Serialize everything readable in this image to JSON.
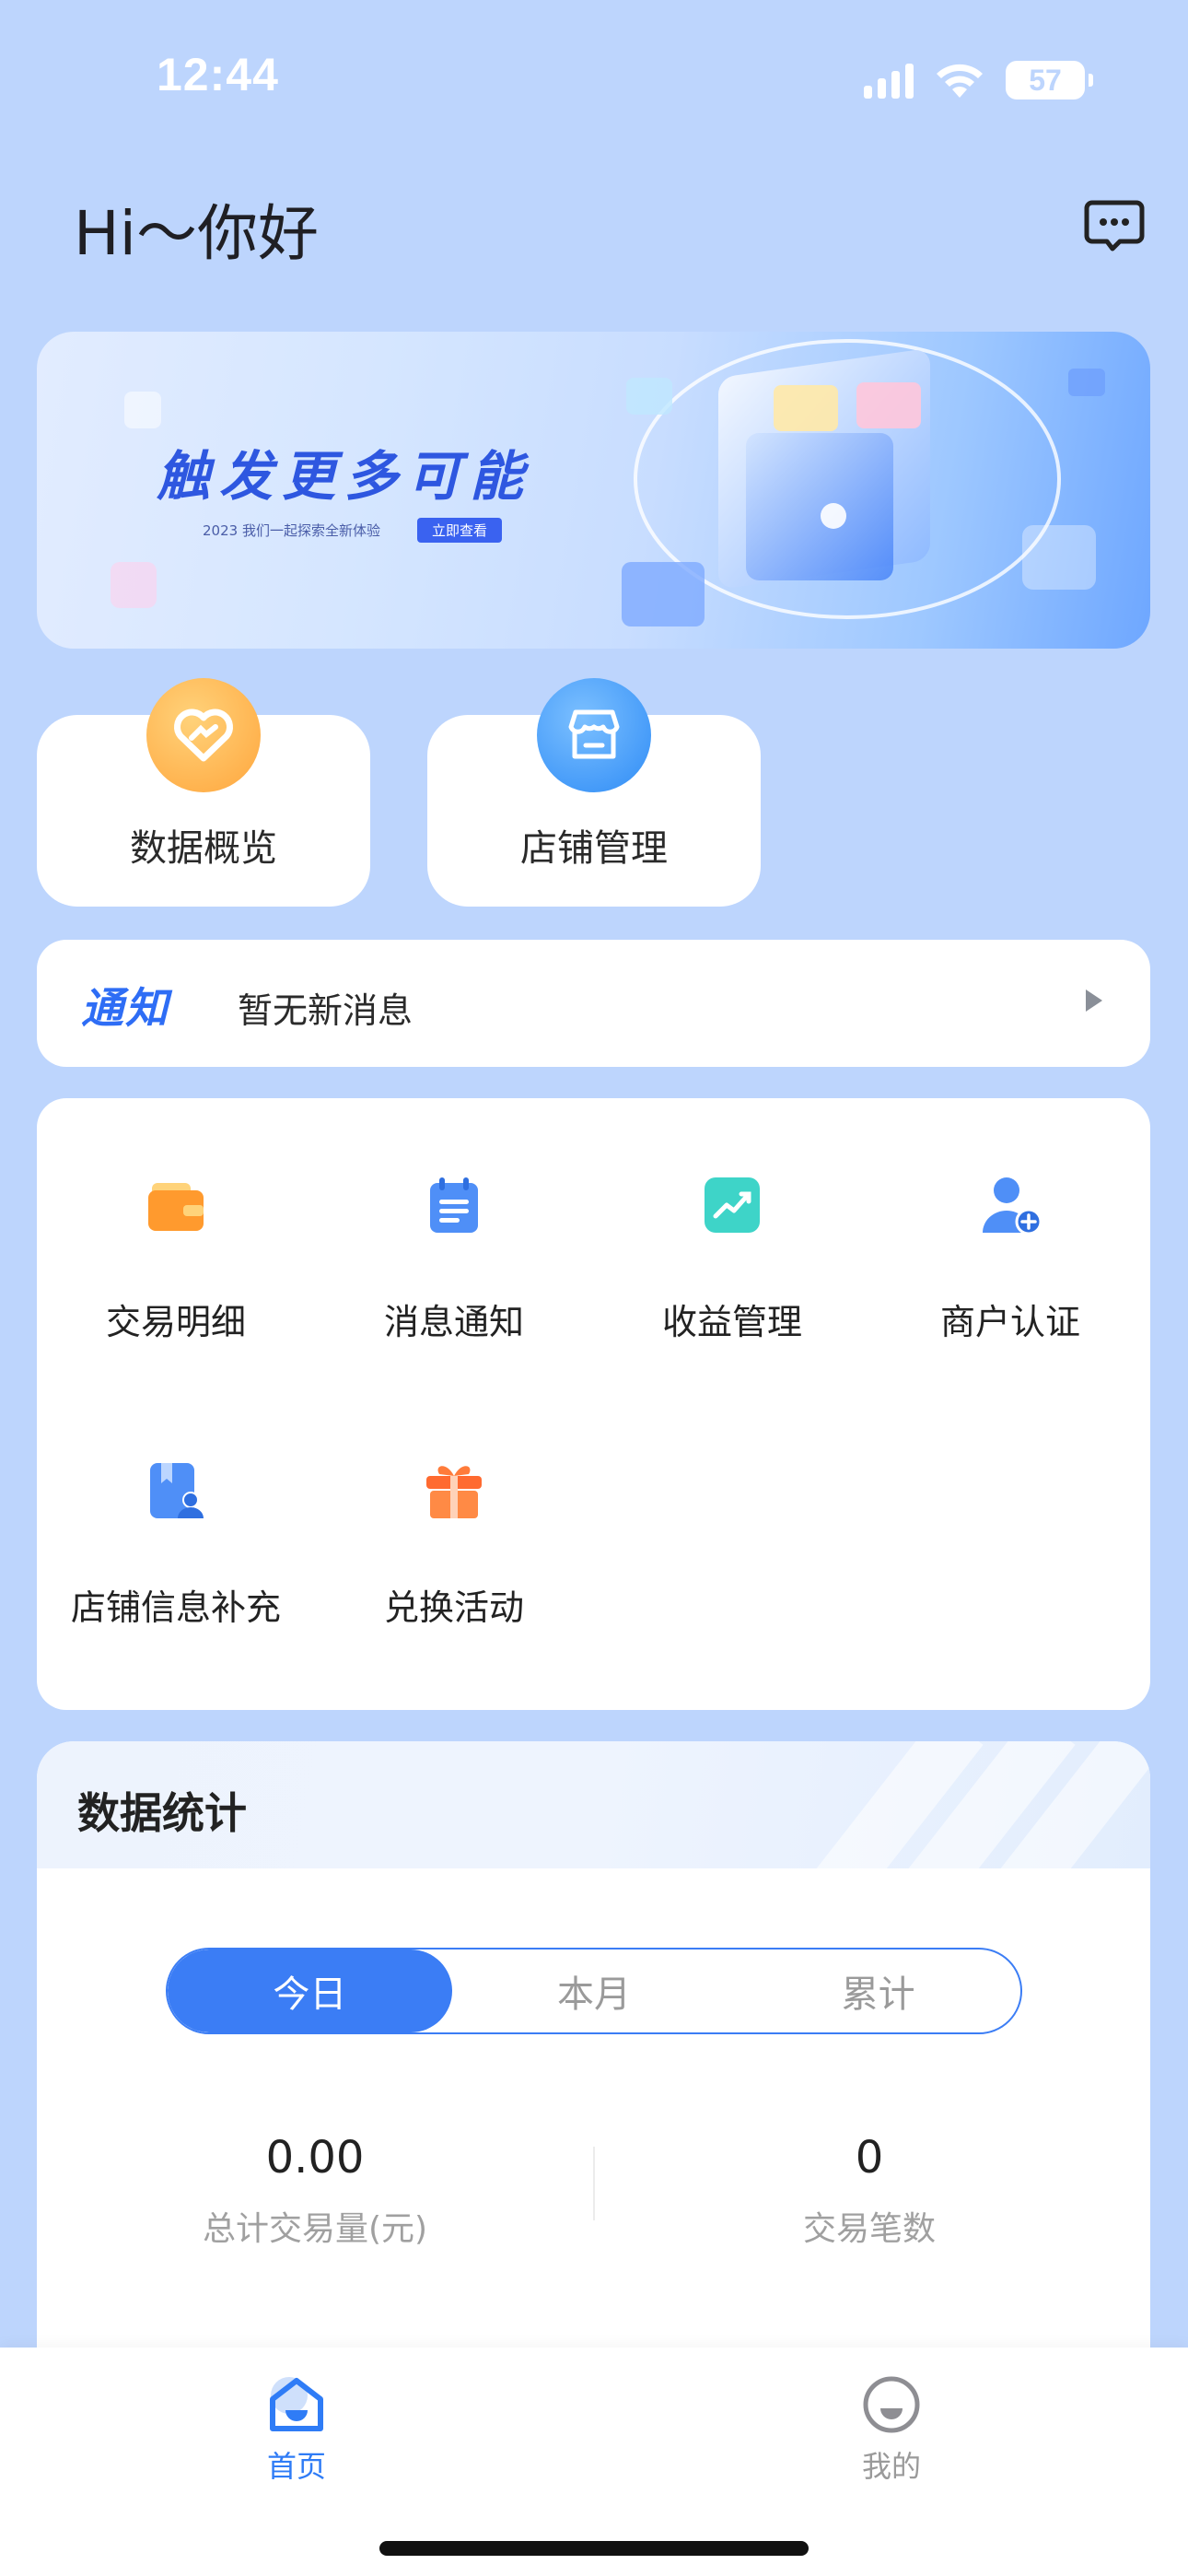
{
  "status_bar": {
    "time": "12:44",
    "battery": "57"
  },
  "header": {
    "greeting": "Hi～你好"
  },
  "banner": {
    "title": "触发更多可能",
    "subtitle": "2023 我们一起探索全新体验",
    "cta": "立即查看"
  },
  "shortcuts": [
    {
      "label": "数据概览",
      "icon": "heart-data-icon",
      "color": "#ffb34d"
    },
    {
      "label": "店铺管理",
      "icon": "store-icon",
      "color": "#3f9cff"
    }
  ],
  "notice": {
    "tag": "通知",
    "text": "暂无新消息"
  },
  "features": [
    {
      "label": "交易明细",
      "icon": "wallet-icon"
    },
    {
      "label": "消息通知",
      "icon": "calendar-list-icon"
    },
    {
      "label": "收益管理",
      "icon": "trend-chart-icon"
    },
    {
      "label": "商户认证",
      "icon": "user-add-icon"
    },
    {
      "label": "店铺信息补充",
      "icon": "profile-book-icon"
    },
    {
      "label": "兑换活动",
      "icon": "gift-icon"
    }
  ],
  "stats": {
    "title": "数据统计",
    "tabs": [
      "今日",
      "本月",
      "累计"
    ],
    "active_tab": "今日",
    "total_amount": {
      "value": "0.00",
      "label": "总计交易量(元)"
    },
    "trade_count": {
      "value": "0",
      "label": "交易笔数"
    }
  },
  "tabbar": {
    "items": [
      {
        "label": "首页",
        "icon": "home-icon",
        "active": true
      },
      {
        "label": "我的",
        "icon": "profile-face-icon",
        "active": false
      }
    ],
    "active_color": "#2f7cf6",
    "inactive_color": "#9a9a9a"
  }
}
